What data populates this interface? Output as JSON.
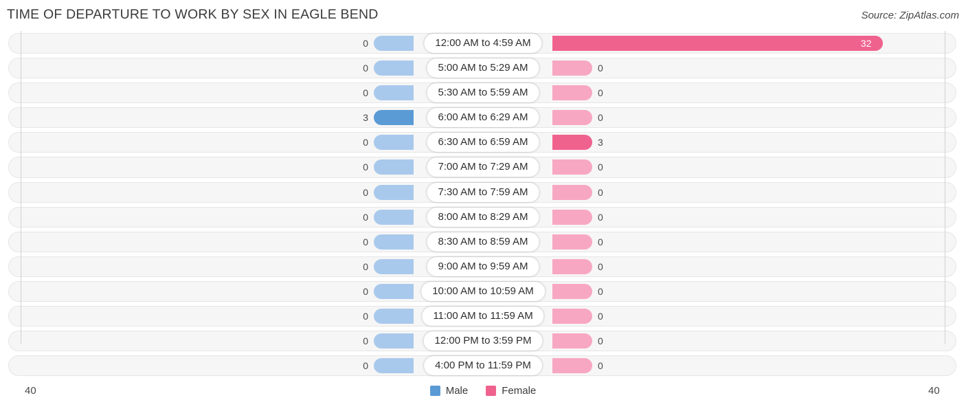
{
  "header": {
    "title": "TIME OF DEPARTURE TO WORK BY SEX IN EAGLE BEND",
    "source": "Source: ZipAtlas.com"
  },
  "footer": {
    "axis_min_label": "40",
    "axis_max_label": "40",
    "legend": [
      {
        "label": "Male",
        "color": "#5b9bd5"
      },
      {
        "label": "Female",
        "color": "#f0628e"
      }
    ]
  },
  "colors": {
    "male_strong": "#5b9bd5",
    "male_faint": "#a9c9ec",
    "female_strong": "#f0628e",
    "female_faint": "#f8a7c2",
    "track": "#f6f6f6",
    "track_border": "#e6e6e6",
    "gridline": "#d0d0d0",
    "text": "#3a3a3a"
  },
  "chart_data": {
    "type": "bar",
    "orientation": "horizontal",
    "style": "diverging-bidirectional",
    "title": "TIME OF DEPARTURE TO WORK BY SEX IN EAGLE BEND",
    "xlabel": "",
    "ylabel": "",
    "xlim": [
      40,
      40
    ],
    "axis_max": 40,
    "grid": true,
    "legend_position": "bottom-center",
    "categories": [
      "12:00 AM to 4:59 AM",
      "5:00 AM to 5:29 AM",
      "5:30 AM to 5:59 AM",
      "6:00 AM to 6:29 AM",
      "6:30 AM to 6:59 AM",
      "7:00 AM to 7:29 AM",
      "7:30 AM to 7:59 AM",
      "8:00 AM to 8:29 AM",
      "8:30 AM to 8:59 AM",
      "9:00 AM to 9:59 AM",
      "10:00 AM to 10:59 AM",
      "11:00 AM to 11:59 AM",
      "12:00 PM to 3:59 PM",
      "4:00 PM to 11:59 PM"
    ],
    "series": [
      {
        "name": "Male",
        "values": [
          0,
          0,
          0,
          3,
          0,
          0,
          0,
          0,
          0,
          0,
          0,
          0,
          0,
          0
        ]
      },
      {
        "name": "Female",
        "values": [
          32,
          0,
          0,
          0,
          3,
          0,
          0,
          0,
          0,
          0,
          0,
          0,
          0,
          0
        ]
      }
    ]
  },
  "rows": [
    {
      "label": "12:00 AM to 4:59 AM",
      "male": "0",
      "female": "32"
    },
    {
      "label": "5:00 AM to 5:29 AM",
      "male": "0",
      "female": "0"
    },
    {
      "label": "5:30 AM to 5:59 AM",
      "male": "0",
      "female": "0"
    },
    {
      "label": "6:00 AM to 6:29 AM",
      "male": "3",
      "female": "0"
    },
    {
      "label": "6:30 AM to 6:59 AM",
      "male": "0",
      "female": "3"
    },
    {
      "label": "7:00 AM to 7:29 AM",
      "male": "0",
      "female": "0"
    },
    {
      "label": "7:30 AM to 7:59 AM",
      "male": "0",
      "female": "0"
    },
    {
      "label": "8:00 AM to 8:29 AM",
      "male": "0",
      "female": "0"
    },
    {
      "label": "8:30 AM to 8:59 AM",
      "male": "0",
      "female": "0"
    },
    {
      "label": "9:00 AM to 9:59 AM",
      "male": "0",
      "female": "0"
    },
    {
      "label": "10:00 AM to 10:59 AM",
      "male": "0",
      "female": "0"
    },
    {
      "label": "11:00 AM to 11:59 AM",
      "male": "0",
      "female": "0"
    },
    {
      "label": "12:00 PM to 3:59 PM",
      "male": "0",
      "female": "0"
    },
    {
      "label": "4:00 PM to 11:59 PM",
      "male": "0",
      "female": "0"
    }
  ]
}
